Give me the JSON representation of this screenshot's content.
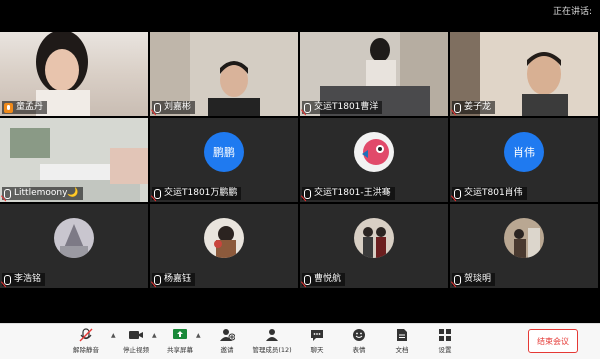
{
  "header": {
    "speaking_label": "正在讲话:"
  },
  "participants": [
    {
      "name": "童孟丹"
    },
    {
      "name": "刘嘉彬"
    },
    {
      "name": "交运T1801曹洋"
    },
    {
      "name": "姜子龙"
    },
    {
      "name": "Littlemoony🌙"
    },
    {
      "name": "交运T1801万鹏鹏",
      "avatar_text": "鹏鹏"
    },
    {
      "name": "交运T1801-王洪骞"
    },
    {
      "name": "交运T801肖伟",
      "avatar_text": "肖伟"
    },
    {
      "name": "李浩铭"
    },
    {
      "name": "杨嘉钰"
    },
    {
      "name": "曹悦航"
    },
    {
      "name": "贺琰明"
    }
  ],
  "toolbar": {
    "unmute": "解除静音",
    "stop_video": "停止视频",
    "share_screen": "共享屏幕",
    "invite": "邀请",
    "manage_members": "管理成员(12)",
    "chat": "聊天",
    "reactions": "表情",
    "docs": "文档",
    "settings": "设置",
    "end_meeting": "结束会议"
  },
  "colors": {
    "accent": "#1f7af0",
    "end": "#e53935",
    "tile_bg": "#2a2a2a"
  }
}
